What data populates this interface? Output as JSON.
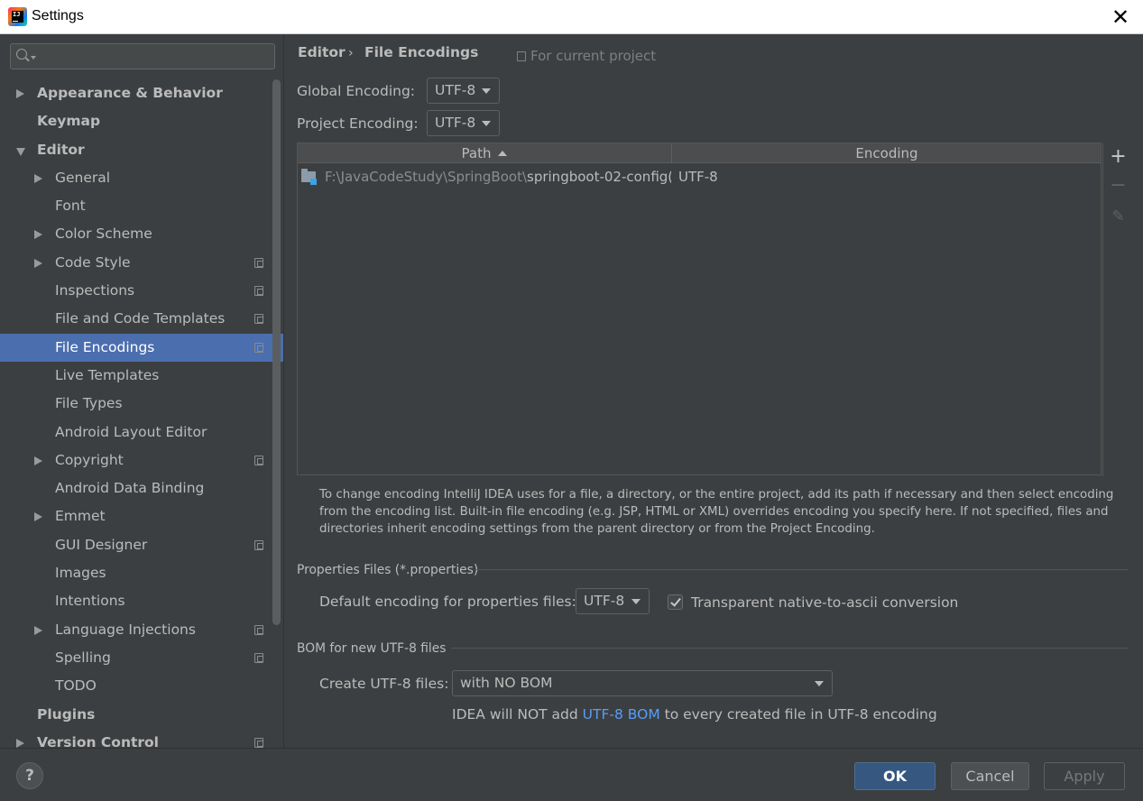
{
  "window": {
    "title": "Settings"
  },
  "sidebar": {
    "search": {
      "value": "",
      "placeholder": ""
    },
    "items": [
      {
        "label": "Appearance & Behavior",
        "level": 0,
        "arrow": "right",
        "bold": true,
        "project": false
      },
      {
        "label": "Keymap",
        "level": 0,
        "arrow": "none",
        "bold": true,
        "project": false
      },
      {
        "label": "Editor",
        "level": 0,
        "arrow": "down",
        "bold": true,
        "project": false
      },
      {
        "label": "General",
        "level": 1,
        "arrow": "right",
        "bold": false,
        "project": false
      },
      {
        "label": "Font",
        "level": 1,
        "arrow": "none",
        "bold": false,
        "project": false
      },
      {
        "label": "Color Scheme",
        "level": 1,
        "arrow": "right",
        "bold": false,
        "project": false
      },
      {
        "label": "Code Style",
        "level": 1,
        "arrow": "right",
        "bold": false,
        "project": true
      },
      {
        "label": "Inspections",
        "level": 1,
        "arrow": "none",
        "bold": false,
        "project": true
      },
      {
        "label": "File and Code Templates",
        "level": 1,
        "arrow": "none",
        "bold": false,
        "project": true
      },
      {
        "label": "File Encodings",
        "level": 1,
        "arrow": "none",
        "bold": false,
        "project": true,
        "selected": true
      },
      {
        "label": "Live Templates",
        "level": 1,
        "arrow": "none",
        "bold": false,
        "project": false
      },
      {
        "label": "File Types",
        "level": 1,
        "arrow": "none",
        "bold": false,
        "project": false
      },
      {
        "label": "Android Layout Editor",
        "level": 1,
        "arrow": "none",
        "bold": false,
        "project": false
      },
      {
        "label": "Copyright",
        "level": 1,
        "arrow": "right",
        "bold": false,
        "project": true
      },
      {
        "label": "Android Data Binding",
        "level": 1,
        "arrow": "none",
        "bold": false,
        "project": false
      },
      {
        "label": "Emmet",
        "level": 1,
        "arrow": "right",
        "bold": false,
        "project": false
      },
      {
        "label": "GUI Designer",
        "level": 1,
        "arrow": "none",
        "bold": false,
        "project": true
      },
      {
        "label": "Images",
        "level": 1,
        "arrow": "none",
        "bold": false,
        "project": false
      },
      {
        "label": "Intentions",
        "level": 1,
        "arrow": "none",
        "bold": false,
        "project": false
      },
      {
        "label": "Language Injections",
        "level": 1,
        "arrow": "right",
        "bold": false,
        "project": true
      },
      {
        "label": "Spelling",
        "level": 1,
        "arrow": "none",
        "bold": false,
        "project": true
      },
      {
        "label": "TODO",
        "level": 1,
        "arrow": "none",
        "bold": false,
        "project": false
      },
      {
        "label": "Plugins",
        "level": 0,
        "arrow": "none",
        "bold": true,
        "project": false
      },
      {
        "label": "Version Control",
        "level": 0,
        "arrow": "right",
        "bold": true,
        "project": true
      }
    ]
  },
  "main": {
    "breadcrumb": {
      "parent": "Editor",
      "separator": "›",
      "current": "File Encodings"
    },
    "for_current_project": "For current project",
    "global_encoding": {
      "label": "Global Encoding:",
      "value": "UTF-8"
    },
    "project_encoding": {
      "label": "Project Encoding:",
      "value": "UTF-8"
    },
    "table": {
      "columns": {
        "path": "Path",
        "encoding": "Encoding"
      },
      "rows": [
        {
          "path_dim": "F:\\JavaCodeStudy\\SpringBoot\\",
          "path_bright": "springboot-02-config(",
          "encoding": "UTF-8"
        }
      ],
      "tools": {
        "add": "+",
        "remove": "−",
        "edit": "✎"
      }
    },
    "help_text": "To change encoding IntelliJ IDEA uses for a file, a directory, or the entire project, add its path if necessary and then select encoding from the encoding list. Built-in file encoding (e.g. JSP, HTML or XML) overrides encoding you specify here. If not specified, files and directories inherit encoding settings from the parent directory or from the Project Encoding.",
    "properties_group": {
      "title": "Properties Files (*.properties)",
      "default_label": "Default encoding for properties files:",
      "default_value": "UTF-8",
      "transparent_label": "Transparent native-to-ascii conversion",
      "transparent_checked": true
    },
    "bom_group": {
      "title": "BOM for new UTF-8 files",
      "create_label": "Create UTF-8 files:",
      "create_value": "with NO BOM",
      "note_before": "IDEA will NOT add ",
      "note_link": "UTF-8 BOM",
      "note_after": " to every created file in UTF-8 encoding"
    }
  },
  "footer": {
    "help": "?",
    "ok": "OK",
    "cancel": "Cancel",
    "apply": "Apply"
  },
  "colors": {
    "background": "#3c3f41",
    "selection": "#4b6eaf",
    "ok_button": "#365880",
    "link": "#589df6"
  }
}
